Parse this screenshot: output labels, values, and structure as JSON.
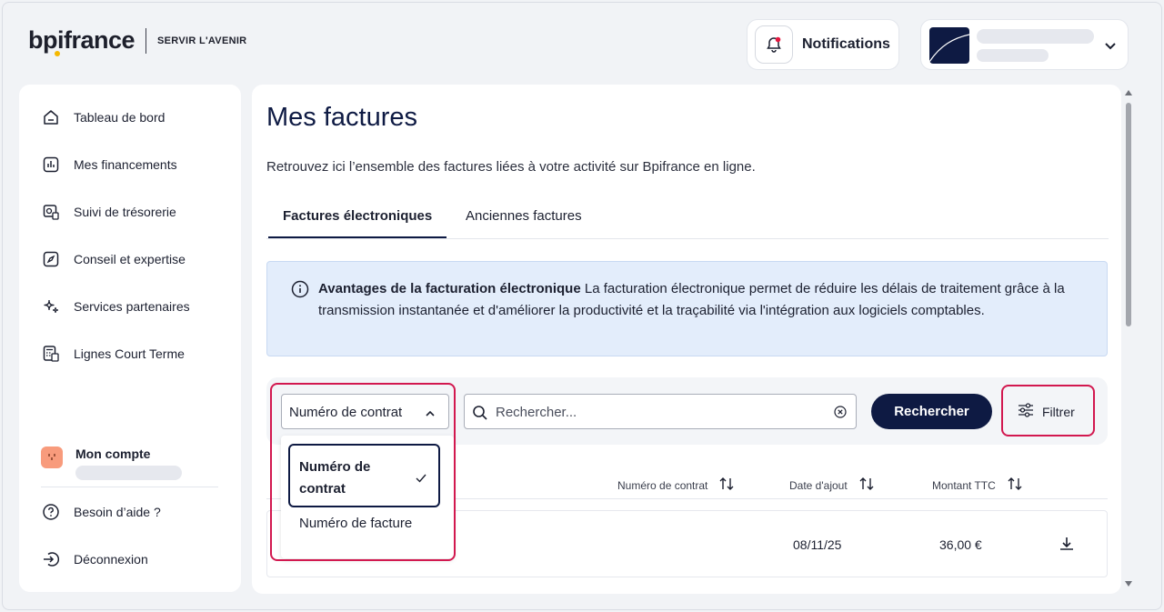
{
  "header": {
    "logo_text": "bpifrance",
    "logo_tagline": "SERVIR L'AVENIR",
    "notifications_label": "Notifications"
  },
  "sidebar": {
    "items": [
      {
        "label": "Tableau de bord",
        "icon": "home-icon"
      },
      {
        "label": "Mes financements",
        "icon": "chart-icon"
      },
      {
        "label": "Suivi de trésorerie",
        "icon": "treasury-icon"
      },
      {
        "label": "Conseil et expertise",
        "icon": "compass-icon"
      },
      {
        "label": "Services partenaires",
        "icon": "sparkle-icon"
      },
      {
        "label": "Lignes Court Terme",
        "icon": "calculator-icon"
      }
    ],
    "account_title": "Mon compte",
    "help_label": "Besoin d’aide ?",
    "logout_label": "Déconnexion"
  },
  "main": {
    "title": "Mes factures",
    "description": "Retrouvez ici l’ensemble des factures liées à votre activité sur Bpifrance en ligne.",
    "tabs": [
      {
        "label": "Factures électroniques",
        "active": true
      },
      {
        "label": "Anciennes factures",
        "active": false
      }
    ],
    "info": {
      "title": "Avantages de la facturation électronique",
      "text": " La facturation électronique permet de réduire les délais de traitement grâce à la transmission instantanée et d'améliorer la productivité et la traçabilité via l'intégration aux logiciels comptables."
    },
    "filters": {
      "select_value": "Numéro de contrat",
      "search_placeholder": "Rechercher...",
      "search_button": "Rechercher",
      "filter_button": "Filtrer"
    },
    "dropdown": {
      "options": [
        "Numéro de contrat",
        "Numéro de facture"
      ],
      "selected": "Numéro de contrat"
    },
    "table": {
      "columns": [
        "Numéro de contrat",
        "Date d'ajout",
        "Montant TTC"
      ],
      "rows": [
        {
          "date": "08/11/25",
          "amount": "36,00 €"
        }
      ]
    }
  },
  "colors": {
    "brand_navy": "#0e1a43",
    "highlight": "#d2184f",
    "info_bg": "#e3edfb"
  }
}
